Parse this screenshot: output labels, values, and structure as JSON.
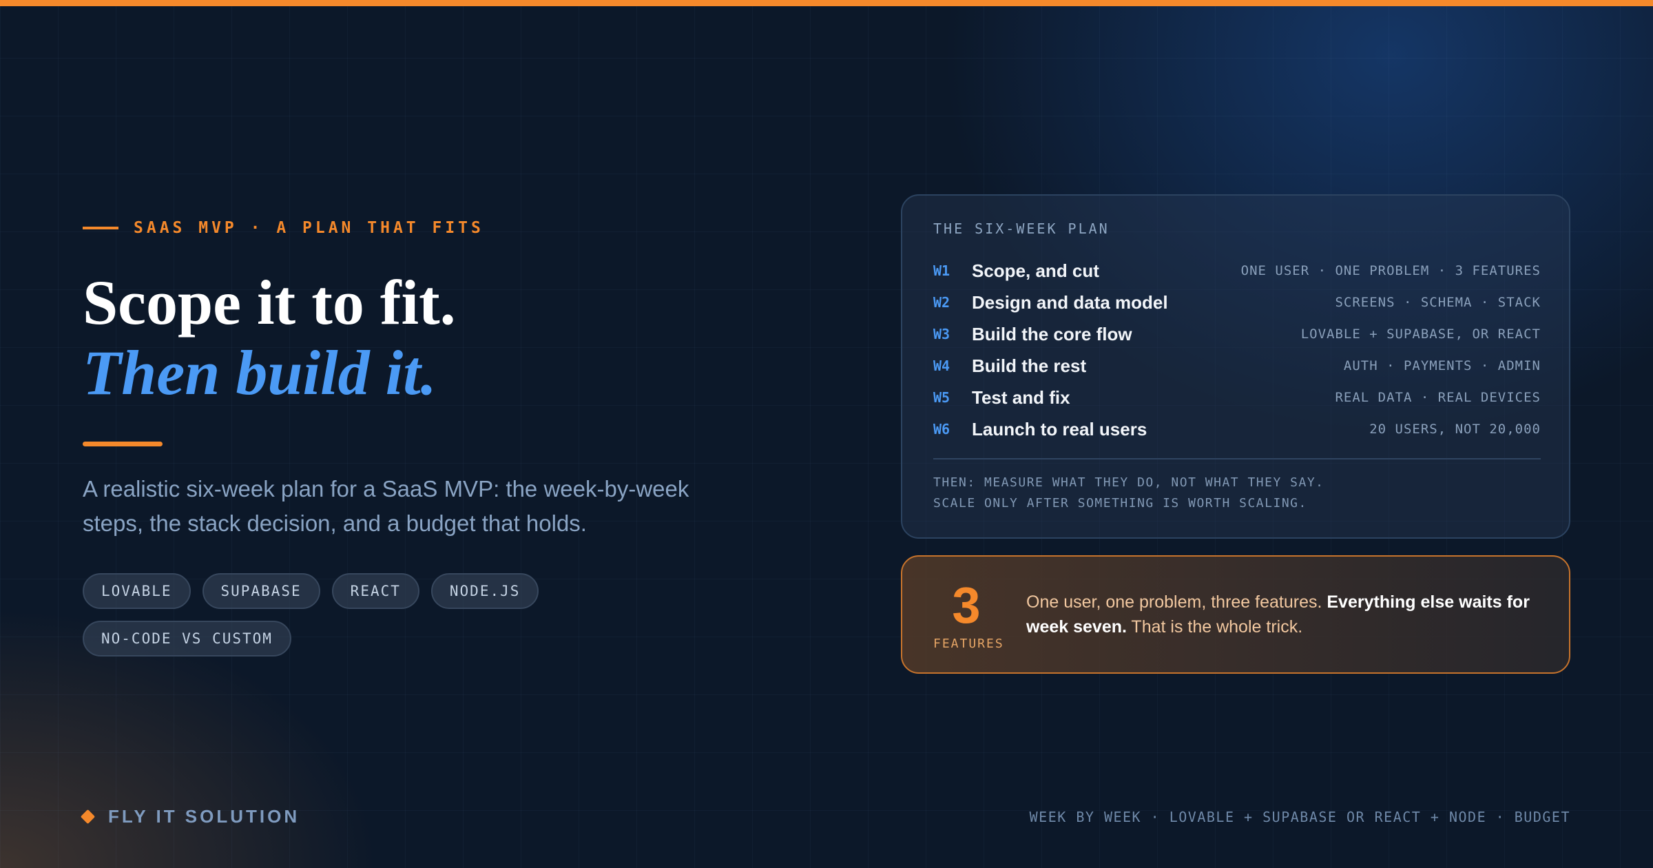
{
  "eyebrow": "SAAS MVP · A PLAN THAT FITS",
  "headline": {
    "line1": "Scope it to fit.",
    "line2": "Then build it."
  },
  "lede": "A realistic six-week plan for a SaaS MVP: the week-by-week steps, the stack decision, and a budget that holds.",
  "tags": [
    "LOVABLE",
    "SUPABASE",
    "REACT",
    "NODE.JS",
    "NO-CODE VS CUSTOM"
  ],
  "plan": {
    "title": "THE SIX-WEEK PLAN",
    "rows": [
      {
        "week": "W1",
        "task": "Scope, and cut",
        "meta": "ONE USER · ONE PROBLEM · 3 FEATURES"
      },
      {
        "week": "W2",
        "task": "Design and data model",
        "meta": "SCREENS · SCHEMA · STACK"
      },
      {
        "week": "W3",
        "task": "Build the core flow",
        "meta": "LOVABLE + SUPABASE, OR REACT"
      },
      {
        "week": "W4",
        "task": "Build the rest",
        "meta": "AUTH · PAYMENTS · ADMIN"
      },
      {
        "week": "W5",
        "task": "Test and fix",
        "meta": "REAL DATA · REAL DEVICES"
      },
      {
        "week": "W6",
        "task": "Launch to real users",
        "meta": "20 USERS, NOT 20,000"
      }
    ],
    "note_line1": "THEN: MEASURE WHAT THEY DO, NOT WHAT THEY SAY.",
    "note_line2": "SCALE ONLY AFTER SOMETHING IS WORTH SCALING."
  },
  "feature": {
    "number": "3",
    "label": "FEATURES",
    "text_start": "One user, one problem, three features. ",
    "text_bold": "Everything else waits for week seven.",
    "text_end": " That is the whole trick."
  },
  "footer": {
    "brand": "FLY IT SOLUTION",
    "meta": "WEEK BY WEEK · LOVABLE + SUPABASE OR REACT + NODE · BUDGET"
  },
  "colors": {
    "accent_orange": "#f5892b",
    "accent_blue": "#4b9af5",
    "background": "#0c1829"
  },
  "icons": {
    "brand_mark": "diamond-icon"
  }
}
